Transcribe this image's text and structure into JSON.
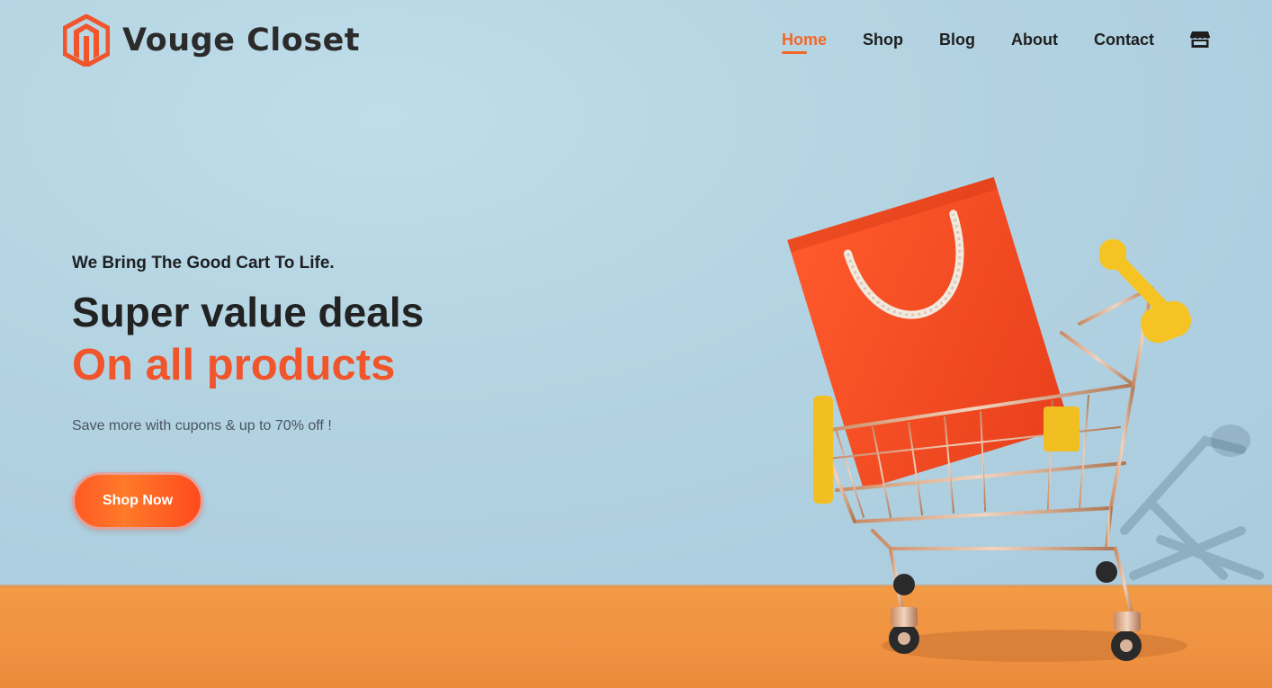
{
  "brand": {
    "name": "Vouge Closet",
    "logo_icon": "hexagon-m-logo-icon",
    "accent_color": "#f2672a"
  },
  "nav": {
    "items": [
      {
        "label": "Home",
        "active": true
      },
      {
        "label": "Shop",
        "active": false
      },
      {
        "label": "Blog",
        "active": false
      },
      {
        "label": "About",
        "active": false
      },
      {
        "label": "Contact",
        "active": false
      }
    ],
    "store_icon": "store-icon"
  },
  "hero": {
    "tagline": "We Bring The Good Cart To Life.",
    "title_line_1": "Super value deals",
    "title_line_2": "On all products",
    "description": "Save more with cupons & up to 70% off !",
    "cta_label": "Shop Now",
    "title_accent_color": "#f0552b"
  },
  "background": {
    "wall_color": "#b3d3e2",
    "floor_color": "#ef9241"
  }
}
